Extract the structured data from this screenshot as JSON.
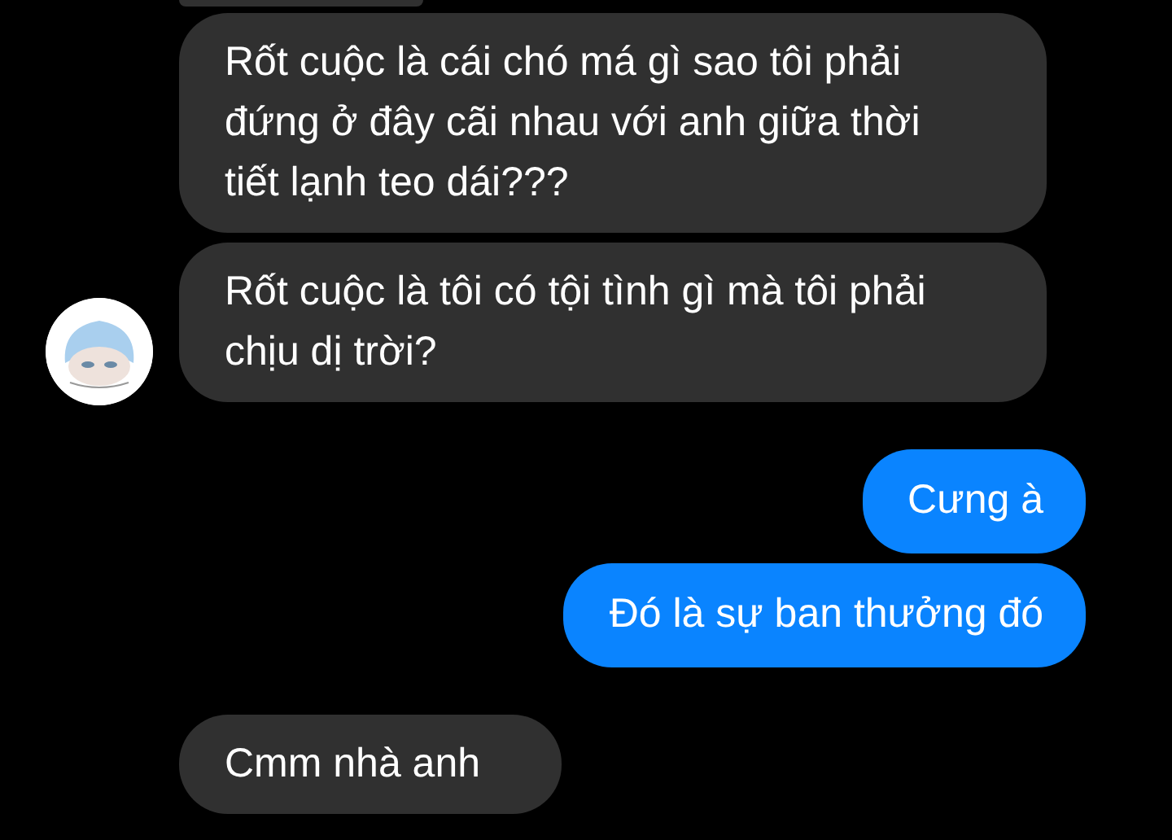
{
  "messages": [
    {
      "kind": "received",
      "text": "Rốt cuộc là cái chó má gì sao tôi phải đứng ở đây cãi nhau với anh giữa thời tiết lạnh teo dái???",
      "avatar": false
    },
    {
      "kind": "received",
      "text": "Rốt cuộc là tôi có tội tình gì mà tôi phải chịu dị trời?",
      "avatar": true
    },
    {
      "kind": "sent",
      "text": "Cưng à",
      "avatar": false
    },
    {
      "kind": "sent",
      "text": "Đó là sự ban thưởng đó",
      "avatar": false
    },
    {
      "kind": "received",
      "text": "Cmm nhà anh",
      "avatar": false
    }
  ]
}
